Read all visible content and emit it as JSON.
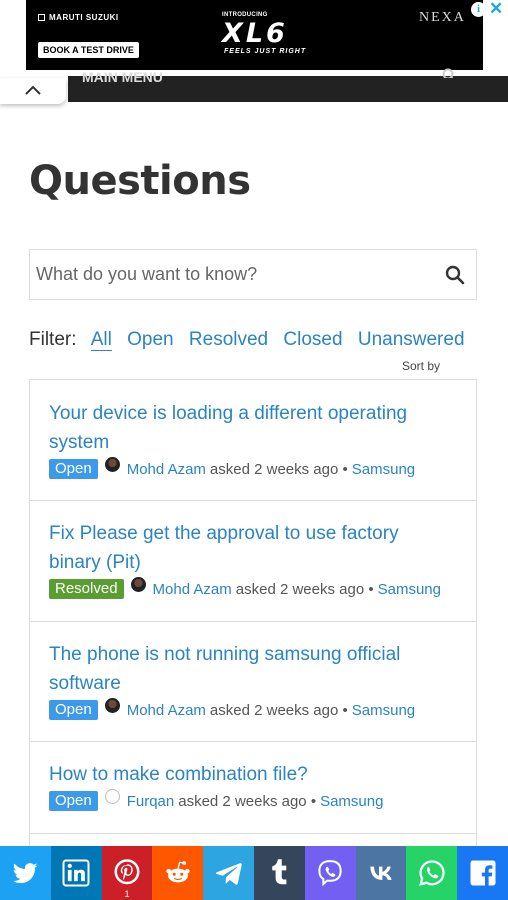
{
  "ad": {
    "brand": "MARUTI SUZUKI",
    "cta": "BOOK A TEST DRIVE",
    "intro": "INTRODUCING",
    "model": "XL6",
    "tagline": "FEELS JUST RIGHT",
    "dealer": "NEXA",
    "info_icon": "i",
    "close_icon": "✕"
  },
  "menu": {
    "label": "MAIN MENU"
  },
  "page": {
    "title": "Questions"
  },
  "search": {
    "placeholder": "What do you want to know?"
  },
  "filter": {
    "label": "Filter:",
    "options": [
      "All",
      "Open",
      "Resolved",
      "Closed",
      "Unanswered"
    ],
    "active": "All",
    "sort_label": "Sort by"
  },
  "questions": [
    {
      "title": "Your device is loading a different operating system",
      "status": "Open",
      "author": "Mohd Azam",
      "asked": "asked 2 weeks ago •",
      "category": "Samsung"
    },
    {
      "title": "Fix Please get the approval to use factory binary (Pit)",
      "status": "Resolved",
      "author": "Mohd Azam",
      "asked": "asked 2 weeks ago •",
      "category": "Samsung"
    },
    {
      "title": "The phone is not running samsung official software",
      "status": "Open",
      "author": "Mohd Azam",
      "asked": "asked 2 weeks ago •",
      "category": "Samsung"
    },
    {
      "title": "How to make combination file?",
      "status": "Open",
      "author": "Furqan",
      "asked": "asked 2 weeks ago •",
      "category": "Samsung"
    }
  ],
  "share": {
    "buttons": [
      {
        "name": "twitter",
        "color": "#1da1f2"
      },
      {
        "name": "linkedin",
        "color": "#0077b5"
      },
      {
        "name": "pinterest",
        "color": "#cb2027",
        "count": "1"
      },
      {
        "name": "reddit",
        "color": "#ff5700"
      },
      {
        "name": "telegram",
        "color": "#2ca5e0"
      },
      {
        "name": "tumblr",
        "color": "#35465c"
      },
      {
        "name": "viber",
        "color": "#7360f2"
      },
      {
        "name": "vk",
        "color": "#4c75a3"
      },
      {
        "name": "whatsapp",
        "color": "#25d366"
      },
      {
        "name": "facebook",
        "color": "#1877f2"
      }
    ]
  },
  "colors": {
    "link": "#2b84c2",
    "open_badge": "#3d9ae8",
    "resolved_badge": "#5a9e32"
  }
}
